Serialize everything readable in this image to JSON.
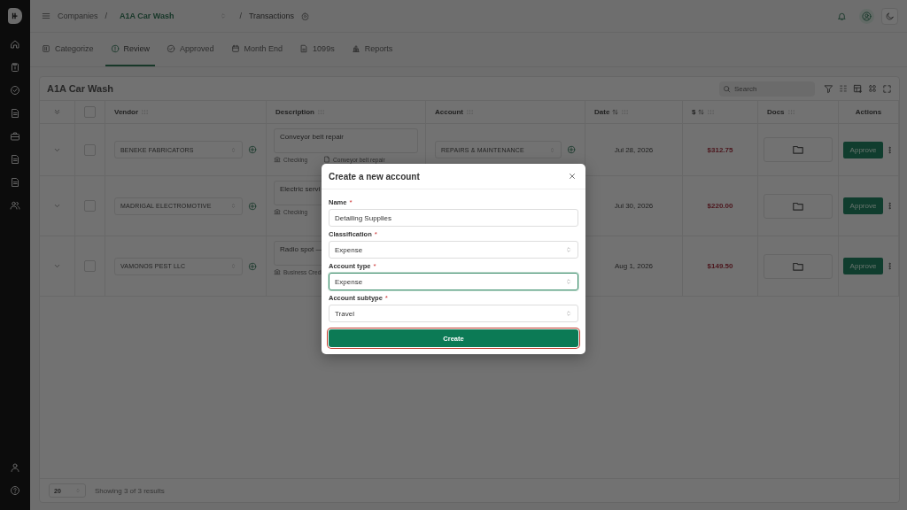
{
  "breadcrumbs": [
    {
      "kind": "link",
      "text": "Companies"
    },
    {
      "kind": "separator",
      "text": "/"
    },
    {
      "kind": "select",
      "text": "A1A Car Wash"
    },
    {
      "kind": "separator",
      "text": "/"
    },
    {
      "kind": "page",
      "text": "Transactions"
    }
  ],
  "tabs": [
    {
      "label": "Categorize",
      "selected": false
    },
    {
      "label": "Review",
      "selected": true
    },
    {
      "label": "Approved",
      "selected": false
    },
    {
      "label": "Month End",
      "selected": false
    },
    {
      "label": "1099s",
      "selected": false
    },
    {
      "label": "Reports",
      "selected": false
    }
  ],
  "table": {
    "title": "A1A Car Wash",
    "search": {
      "placeholder": "Search"
    },
    "all_checked": false,
    "columns": [
      {
        "label": "Vendor",
        "sortable": false,
        "grip": true
      },
      {
        "label": "Description",
        "sortable": false,
        "grip": true
      },
      {
        "label": "Account",
        "sortable": false,
        "grip": true
      },
      {
        "label": "Date",
        "sortable": true,
        "grip": true
      },
      {
        "label": "$",
        "sortable": true,
        "grip": true
      },
      {
        "label": "Docs",
        "sortable": false,
        "grip": true
      },
      {
        "label": "Actions",
        "sortable": false,
        "grip": false
      }
    ],
    "rows": [
      {
        "checked": false,
        "vendor": "BENEKE FABRICATORS",
        "description": "Conveyor belt repair",
        "bank": "Checking",
        "attachment": "Conveyor belt repair",
        "account": "REPAIRS & MAINTENANCE",
        "date": "Jul 28, 2026",
        "amount": "$312.75",
        "action": "Approve"
      },
      {
        "checked": false,
        "vendor": "MADRIGAL ELECTROMOTIVE",
        "description": "Electric servi",
        "bank": "Checking",
        "date": "Jul 30, 2026",
        "amount": "$220.00",
        "action": "Approve"
      },
      {
        "checked": false,
        "vendor": "VAMONOS PEST LLC",
        "description": "Radio spot —",
        "bank": "Business Credi",
        "date": "Aug 1, 2026",
        "amount": "$149.50",
        "action": "Approve"
      }
    ],
    "page_size": "20",
    "summary": "Showing 3 of 3 results"
  },
  "modal": {
    "title": "Create a new account",
    "fields": [
      {
        "kind": "text",
        "label": "Name",
        "required_mark": "*",
        "value": "Detailing Supplies",
        "focused": false
      },
      {
        "kind": "select",
        "label": "Classification",
        "required_mark": "*",
        "value": "Expense",
        "focused": false
      },
      {
        "kind": "select",
        "label": "Account type",
        "required_mark": "*",
        "value": "Expense",
        "focused": true
      },
      {
        "kind": "select",
        "label": "Account subtype",
        "required_mark": "*",
        "value": "Travel",
        "focused": false
      }
    ],
    "submit": {
      "label": "Create",
      "focused": true
    }
  }
}
